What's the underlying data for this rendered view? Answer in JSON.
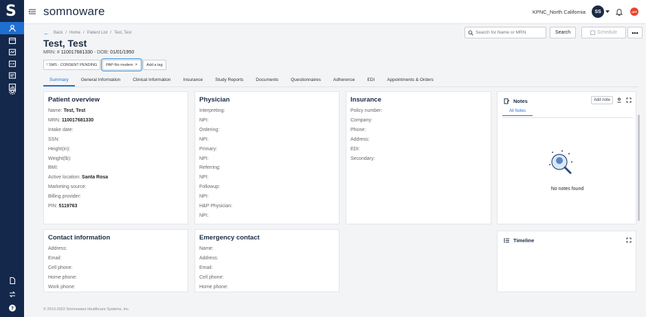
{
  "app": {
    "brand": "somnoware",
    "organization": "KPNC_North California",
    "user_initials": "SS",
    "status_badge": "OFF"
  },
  "breadcrumb": [
    "Back",
    "Home",
    "Patient List",
    "Test, Test"
  ],
  "patient": {
    "name": "Test, Test",
    "mrn_label": "MRN: #",
    "mrn": "110017681330",
    "dob_label": "- DOB:",
    "dob": "01/01/1950"
  },
  "tags": [
    {
      "label": "! SMS - CONSENT PENDING"
    },
    {
      "label": "PAP-No modem",
      "removable": "×"
    },
    {
      "label": "Add a tag"
    }
  ],
  "header_actions": {
    "search_placeholder": "Search for Name or MRN",
    "search_button": "Search",
    "schedule_button": "Schedule",
    "more_button": "•••"
  },
  "tabs": [
    "Summary",
    "General Information",
    "Clinical Information",
    "Insurance",
    "Study Reports",
    "Documents",
    "Questionnaires",
    "Adherence",
    "EDI",
    "Appointments & Orders"
  ],
  "patient_overview": {
    "title": "Patient overview",
    "rows": [
      {
        "label": "Name:",
        "value": "Test, Test"
      },
      {
        "label": "MRN:",
        "value": "110017681330"
      },
      {
        "label": "Intake date:",
        "value": ""
      },
      {
        "label": "SSN:",
        "value": ""
      },
      {
        "label": "Height(in):",
        "value": ""
      },
      {
        "label": "Weight(lb):",
        "value": ""
      },
      {
        "label": "BMI:",
        "value": ""
      },
      {
        "label": "Active location:",
        "value": "Santa Rosa"
      },
      {
        "label": "Marketing source:",
        "value": ""
      },
      {
        "label": "Billing provider:",
        "value": ""
      },
      {
        "label": "PIN:",
        "value": "5119763"
      }
    ]
  },
  "physician": {
    "title": "Physician",
    "rows": [
      "Interpreting:",
      "NPI:",
      "Ordering:",
      "NPI:",
      "Primary:",
      "NPI:",
      "Referring:",
      "NPI:",
      "Followup:",
      "NPI:",
      "H&P Physician:",
      "NPI:"
    ]
  },
  "insurance": {
    "title": "Insurance",
    "rows": [
      "Policy number:",
      "Company:",
      "Phone:",
      "Address:",
      "EDI:",
      "Secondary:"
    ]
  },
  "notes": {
    "title": "Notes",
    "add_button": "Add note",
    "subtab": "All Notes",
    "empty_text": "No notes found"
  },
  "contact": {
    "title": "Contact information",
    "rows": [
      "Address:",
      "Email:",
      "Cell phone:",
      "Home phone:",
      "Work phone:"
    ]
  },
  "emergency": {
    "title": "Emergency contact",
    "rows": [
      "Name:",
      "Address:",
      "Email:",
      "Cell phone:",
      "Home phone:"
    ]
  },
  "timeline": {
    "title": "Timeline"
  },
  "footer": "© 2013-2022 Somnoware Healthcare Systems, Inc.",
  "colors": {
    "rail": "#13284b",
    "accent": "#1f6fd1",
    "status": "#e8452d"
  }
}
